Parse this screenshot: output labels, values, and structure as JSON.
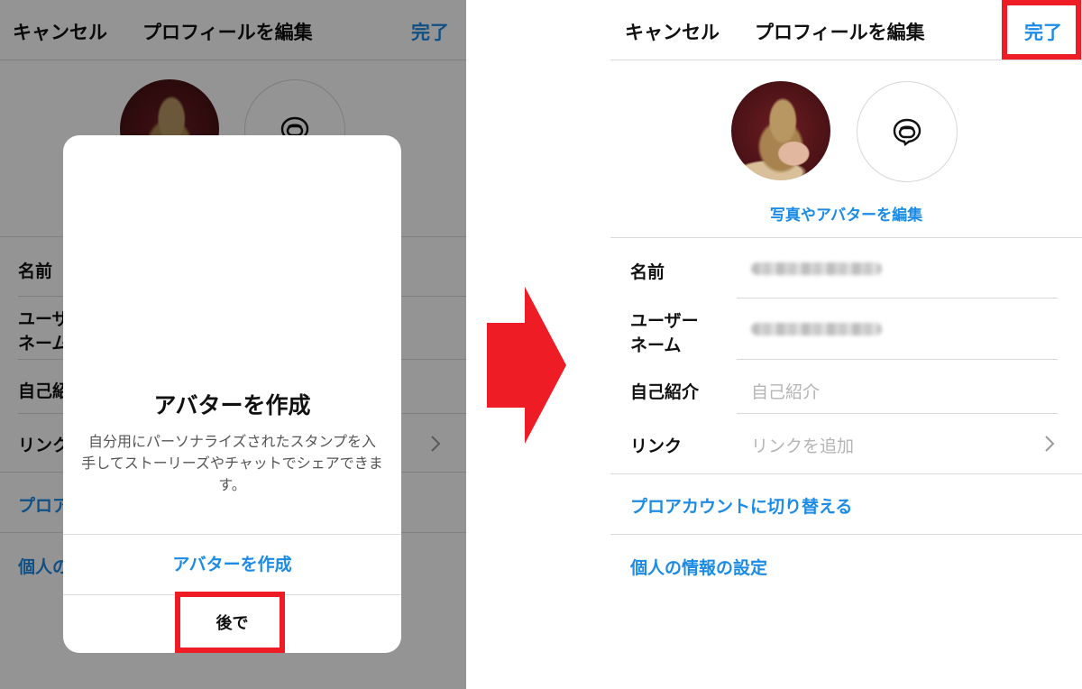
{
  "header": {
    "cancel": "キャンセル",
    "title": "プロフィールを編集",
    "done": "完了"
  },
  "left": {
    "rows": {
      "name": "名前",
      "username_line1": "ユーザ",
      "username_line2": "ネーム",
      "bio": "自己紹",
      "link": "リンク",
      "pro": "プロア",
      "personal": "個人の"
    },
    "modal": {
      "title": "アバターを作成",
      "description": "自分用にパーソナライズされたスタンプを入手してストーリーズやチャットでシェアできます。",
      "create_button": "アバターを作成",
      "later_button": "後で"
    }
  },
  "right": {
    "edit_photo_link": "写真やアバターを編集",
    "fields": {
      "name_label": "名前",
      "username_label_line1": "ユーザー",
      "username_label_line2": "ネーム",
      "bio_label": "自己紹介",
      "bio_placeholder": "自己紹介",
      "link_label": "リンク",
      "link_placeholder": "リンクを追加"
    },
    "switch_pro": "プロアカウントに切り替える",
    "personal_info": "個人の情報の設定"
  },
  "colors": {
    "accent_blue": "#1c8be6",
    "highlight_red": "#ee1c25"
  },
  "icons": {
    "arrow": "right-arrow-icon",
    "avatar_sticker": "avatar-sticker-icon",
    "chevron": "chevron-right-icon"
  }
}
